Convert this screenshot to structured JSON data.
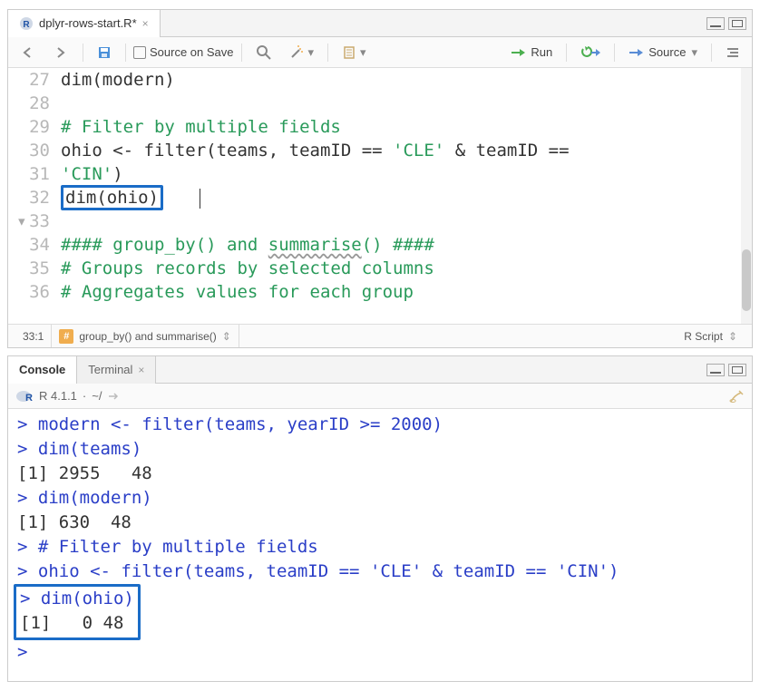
{
  "editor_tab": {
    "filename": "dplyr-rows-start.R*",
    "icon": "r-script-icon"
  },
  "toolbar": {
    "source_on_save": "Source on Save",
    "run": "Run",
    "source_btn": "Source"
  },
  "gutter": [
    "27",
    "28",
    "29",
    "30",
    "",
    "31",
    "32",
    "33",
    "34",
    "35",
    "36"
  ],
  "code": {
    "l27": "dim(modern)",
    "l29_com": "# Filter by multiple fields",
    "l30a": "ohio <- filter(teams, teamID == ",
    "l30s1": "'CLE'",
    "l30b": " & teamID ==",
    "l30c": "'CIN'",
    "l30d": ")",
    "l31": "dim(ohio)",
    "l33": "#### group_by() and summarise() ####",
    "l33_a": "#### group_by() and ",
    "l33_b": "summarise",
    "l33_c": "() ####",
    "l34": "# Groups records by selected columns",
    "l35": "# Aggregates values for each group"
  },
  "statusbar": {
    "pos": "33:1",
    "section": "group_by() and summarise()",
    "lang": "R Script"
  },
  "console_tabs": {
    "console": "Console",
    "terminal": "Terminal"
  },
  "console_sub": {
    "version": "R 4.1.1",
    "path": "~/"
  },
  "console_lines": [
    {
      "t": "cmd",
      "text": "modern <- filter(teams, yearID >= 2000)"
    },
    {
      "t": "cmd",
      "text": "dim(teams)"
    },
    {
      "t": "out",
      "text": "[1] 2955   48"
    },
    {
      "t": "cmd",
      "text": "dim(modern)"
    },
    {
      "t": "out",
      "text": "[1] 630  48"
    },
    {
      "t": "cmd",
      "text": "# Filter by multiple fields"
    },
    {
      "t": "cmd",
      "text": "ohio <- filter(teams, teamID == 'CLE' & teamID == 'CIN')"
    },
    {
      "t": "cmd",
      "text": "dim(ohio)",
      "boxed": true
    },
    {
      "t": "out",
      "text": "[1]   0 48",
      "boxed": true
    },
    {
      "t": "cmd",
      "text": ""
    }
  ]
}
